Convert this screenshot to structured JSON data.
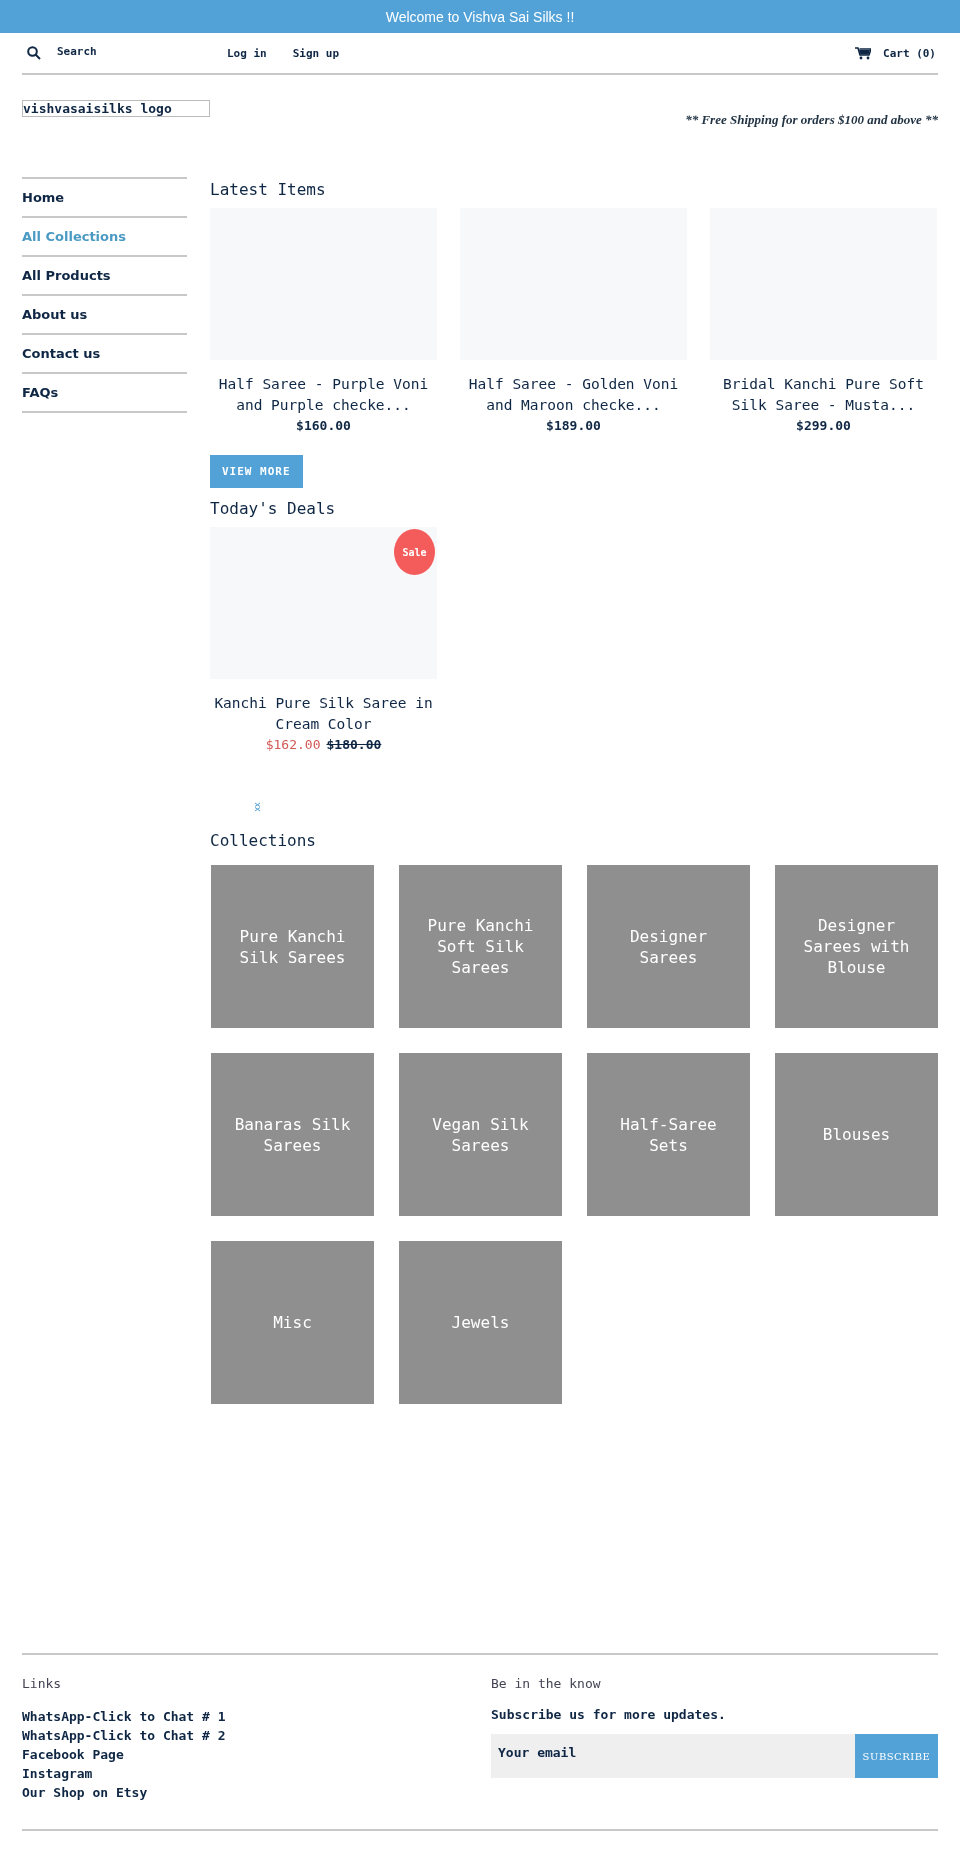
{
  "announcement": "Welcome to Vishva Sai Silks !!",
  "header": {
    "search": "Search",
    "links": [
      "Log in",
      "Sign up"
    ],
    "cart": "Cart (0)"
  },
  "logo": "vishvasaisilks logo",
  "shipping_note": "** Free Shipping for orders $100 and above **",
  "sidebar": {
    "items": [
      {
        "label": "Home",
        "selected": false
      },
      {
        "label": "All Collections",
        "selected": true
      },
      {
        "label": "All Products",
        "selected": false
      },
      {
        "label": "About us",
        "selected": false
      },
      {
        "label": "Contact us",
        "selected": false
      },
      {
        "label": "FAQs",
        "selected": false
      }
    ]
  },
  "latest": {
    "title": "Latest Items",
    "products": [
      {
        "title": "Half Saree - Purple Voni and Purple checke...",
        "price": "$160.00"
      },
      {
        "title": "Half Saree - Golden Voni and Maroon checke...",
        "price": "$189.00"
      },
      {
        "title": "Bridal Kanchi Pure Soft Silk Saree - Musta...",
        "price": "$299.00"
      }
    ],
    "button": "VIEW MORE"
  },
  "deals": {
    "title": "Today's Deals",
    "products": [
      {
        "title": "Kanchi Pure Silk Saree in Cream Color",
        "badge": "Sale",
        "price": "$162.00",
        "compare_price": "$180.00"
      }
    ]
  },
  "collections": {
    "title": "Collections",
    "items": [
      "Pure Kanchi Silk Sarees",
      "Pure Kanchi Soft Silk Sarees",
      "Designer Sarees",
      "Designer Sarees with Blouse",
      "Banaras Silk Sarees",
      "Vegan Silk Sarees",
      "Half-Saree Sets",
      "Blouses",
      "Misc",
      "Jewels"
    ]
  },
  "footer": {
    "links_title": "Links",
    "links": [
      "WhatsApp-Click to Chat # 1",
      "WhatsApp-Click to Chat # 2",
      "Facebook Page",
      "Instagram",
      "Our Shop on Etsy"
    ],
    "newsletter_title": "Be in the know",
    "newsletter_text": "Subscribe us for more updates.",
    "email_placeholder": "Your email",
    "subscribe": "SUBSCRIBE"
  }
}
